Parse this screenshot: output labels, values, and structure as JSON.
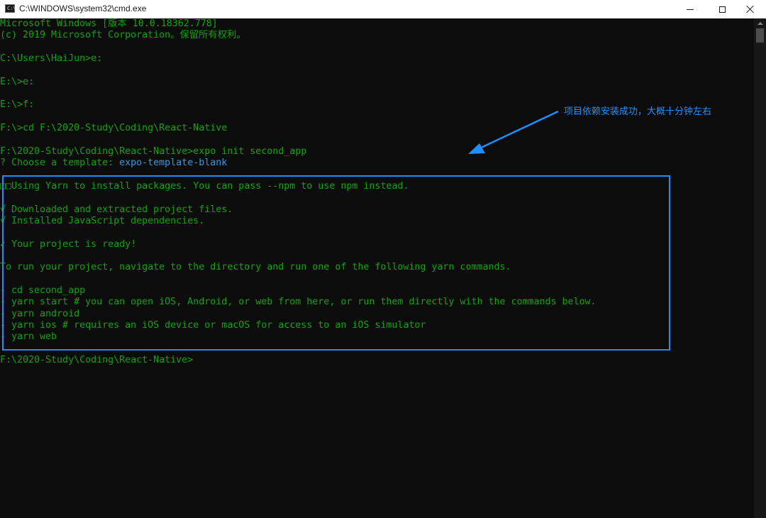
{
  "window": {
    "title": "C:\\WINDOWS\\system32\\cmd.exe",
    "icon_text": "C:\\"
  },
  "console": {
    "lines": [
      [
        {
          "t": "Microsoft Windows [版本 10.0.18362.778]"
        }
      ],
      [
        {
          "t": "(c) 2019 Microsoft Corporation。保留所有权利。"
        }
      ],
      [
        {
          "t": ""
        }
      ],
      [
        {
          "t": "C:\\Users\\HaiJun>e:"
        }
      ],
      [
        {
          "t": ""
        }
      ],
      [
        {
          "t": "E:\\>e:"
        }
      ],
      [
        {
          "t": ""
        }
      ],
      [
        {
          "t": "E:\\>f:"
        }
      ],
      [
        {
          "t": ""
        }
      ],
      [
        {
          "t": "F:\\>cd F:\\2020-Study\\Coding\\React-Native"
        }
      ],
      [
        {
          "t": ""
        }
      ],
      [
        {
          "t": "F:\\2020-Study\\Coding\\React-Native>expo init second_app"
        }
      ],
      [
        {
          "t": "? Choose a template: "
        },
        {
          "t": "expo-template-blank",
          "c": "accent"
        }
      ],
      [
        {
          "t": ""
        }
      ],
      [
        {
          "t": "□□Using Yarn to install packages. You can pass --npm to use npm instead."
        }
      ],
      [
        {
          "t": ""
        }
      ],
      [
        {
          "t": "√ Downloaded and extracted project files."
        }
      ],
      [
        {
          "t": "√ Installed JavaScript dependencies."
        }
      ],
      [
        {
          "t": ""
        }
      ],
      [
        {
          "t": "✓ Your project is ready!"
        }
      ],
      [
        {
          "t": ""
        }
      ],
      [
        {
          "t": "To run your project, navigate to the directory and run one of the following yarn commands."
        }
      ],
      [
        {
          "t": ""
        }
      ],
      [
        {
          "t": "- cd second_app"
        }
      ],
      [
        {
          "t": "- yarn start # you can open iOS, Android, or web from here, or run them directly with the commands below."
        }
      ],
      [
        {
          "t": "- yarn android"
        }
      ],
      [
        {
          "t": "- yarn ios # requires an iOS device or macOS for access to an iOS simulator"
        }
      ],
      [
        {
          "t": "- yarn web"
        }
      ],
      [
        {
          "t": ""
        }
      ],
      [
        {
          "t": "F:\\2020-Study\\Coding\\React-Native>"
        }
      ]
    ]
  },
  "annotation": {
    "text": "项目依赖安装成功，大概十分钟左右"
  },
  "colors": {
    "console_text": "#13a10e",
    "console_bg": "#0c0c0c",
    "highlight": "#1f8fff",
    "accent_text": "#3a96dd"
  }
}
